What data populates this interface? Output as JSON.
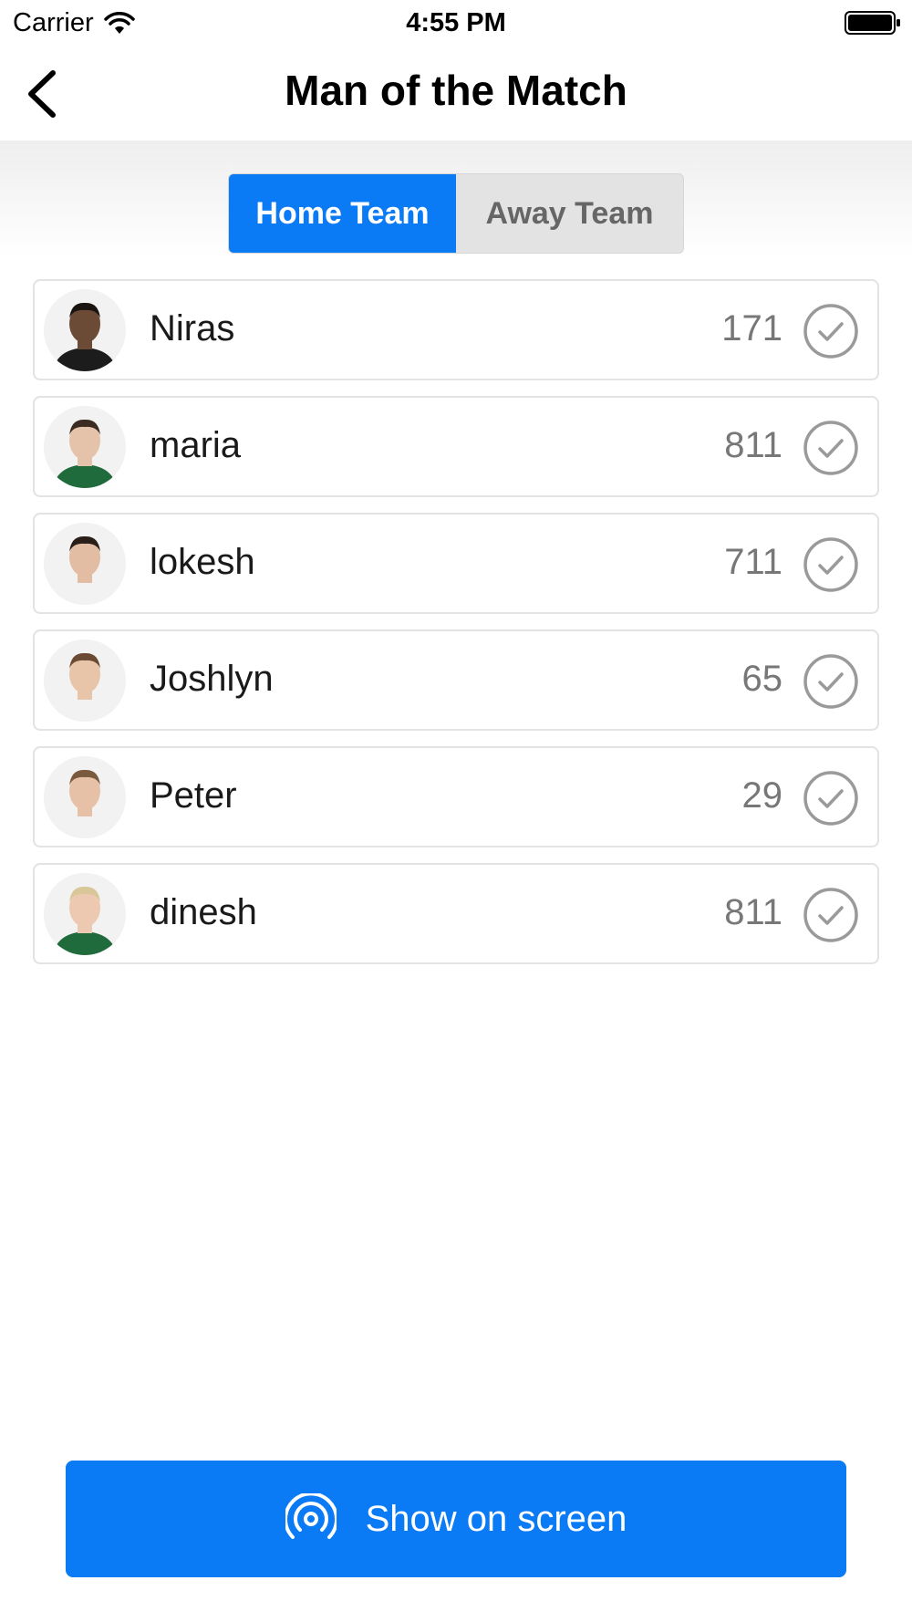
{
  "status_bar": {
    "carrier": "Carrier",
    "time": "4:55 PM"
  },
  "nav": {
    "title": "Man of the Match"
  },
  "tabs": [
    {
      "label": "Home Team",
      "selected": true
    },
    {
      "label": "Away Team",
      "selected": false
    }
  ],
  "players": [
    {
      "name": "Niras",
      "votes": "171",
      "avatar_skin": "#6b4a36",
      "avatar_hair": "#1a1410",
      "avatar_shirt": "#1c1c1c"
    },
    {
      "name": "maria",
      "votes": "811",
      "avatar_skin": "#e5c3aa",
      "avatar_hair": "#3b2b20",
      "avatar_shirt": "#1f6b3b"
    },
    {
      "name": "lokesh",
      "votes": "711",
      "avatar_skin": "#e2bca3",
      "avatar_hair": "#2a1f18",
      "avatar_shirt": "#f2f2f2"
    },
    {
      "name": "Joshlyn",
      "votes": "65",
      "avatar_skin": "#e8c4a9",
      "avatar_hair": "#6a4a32",
      "avatar_shirt": "#f2f2f2"
    },
    {
      "name": "Peter",
      "votes": "29",
      "avatar_skin": "#e6c1a7",
      "avatar_hair": "#7a5a3c",
      "avatar_shirt": "#f2f2f2"
    },
    {
      "name": "dinesh",
      "votes": "811",
      "avatar_skin": "#ecc9b0",
      "avatar_hair": "#d9c79a",
      "avatar_shirt": "#1f6b3b"
    }
  ],
  "actions": {
    "show_on_screen_label": "Show on screen"
  },
  "colors": {
    "accent": "#0a7af5",
    "check": "#9a9a9a"
  },
  "icons": {
    "back": "chevron-left-icon",
    "vote": "check-circle-icon",
    "broadcast": "broadcast-icon",
    "wifi": "wifi-icon",
    "battery": "battery-icon"
  }
}
